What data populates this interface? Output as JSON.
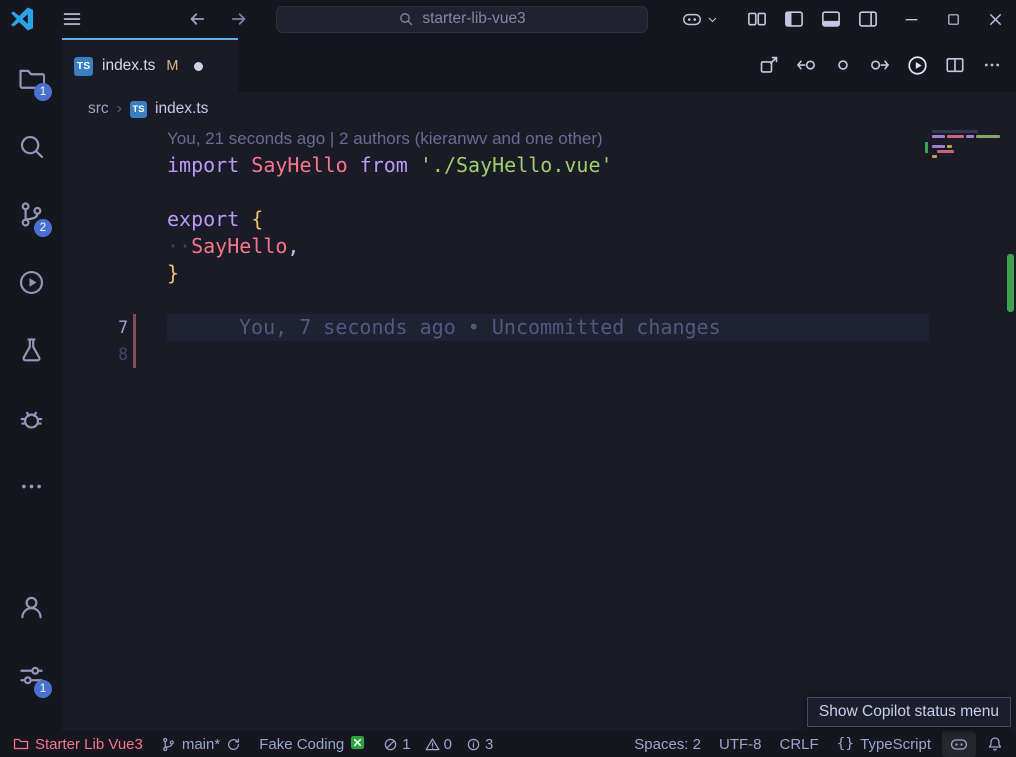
{
  "titlebar": {
    "search_value": "starter-lib-vue3"
  },
  "icons": {
    "chevron_right": "›"
  },
  "file_icons": {
    "ts": "TS"
  },
  "activity_bar": {
    "explorer_badge": "1",
    "scm_badge": "2",
    "manage_badge": "1"
  },
  "tab": {
    "label": "index.ts",
    "git_status": "M"
  },
  "breadcrumb": {
    "folder": "src",
    "file": "index.ts"
  },
  "editor": {
    "codelens": "You, 21 seconds ago | 2 authors (kieranwv and one other)",
    "syntax_colors": {
      "keyword": "#bb9af7",
      "variable": "#f7768e",
      "string": "#9ece6a",
      "brace": "#e8c264",
      "punctuation": "#c0caf5",
      "whitespace": "#3b4261"
    },
    "code_lines": [
      {
        "n": "",
        "tokens": [
          [
            "kw",
            "import"
          ],
          [
            "pl",
            " "
          ],
          [
            "var",
            "SayHello"
          ],
          [
            "pl",
            " "
          ],
          [
            "kw",
            "from"
          ],
          [
            "pl",
            " "
          ],
          [
            "str",
            "'./SayHello.vue'"
          ]
        ]
      },
      {
        "n": "",
        "tokens": []
      },
      {
        "n": "",
        "tokens": [
          [
            "kw",
            "export"
          ],
          [
            "pl",
            " "
          ],
          [
            "brace",
            "{"
          ]
        ]
      },
      {
        "n": "",
        "tokens": [
          [
            "ws",
            "··"
          ],
          [
            "var",
            "SayHello"
          ],
          [
            "pl",
            ","
          ]
        ]
      },
      {
        "n": "",
        "tokens": [
          [
            "brace",
            "}"
          ]
        ]
      },
      {
        "n": "",
        "tokens": []
      },
      {
        "n": "7",
        "active": true,
        "changed": true,
        "blame": "You, 7 seconds ago • Uncommitted changes",
        "tokens": []
      },
      {
        "n": "8",
        "changed": true,
        "tokens": []
      }
    ]
  },
  "statusbar": {
    "workspace": "Starter Lib Vue3",
    "branch": "main*",
    "task": "Fake Coding",
    "errors": "1",
    "warnings": "0",
    "infos": "3",
    "indentation": "Spaces: 2",
    "encoding": "UTF-8",
    "eol": "CRLF",
    "language_icon": "{}",
    "language": "TypeScript"
  },
  "tooltip": {
    "text": "Show Copilot status menu"
  },
  "theme": {
    "accent_blue": "#62aeef",
    "badge_blue": "#4971cf",
    "status_pink": "#f7768e",
    "git_modified_orange": "#e0af68",
    "added_green": "#3fa34d"
  }
}
